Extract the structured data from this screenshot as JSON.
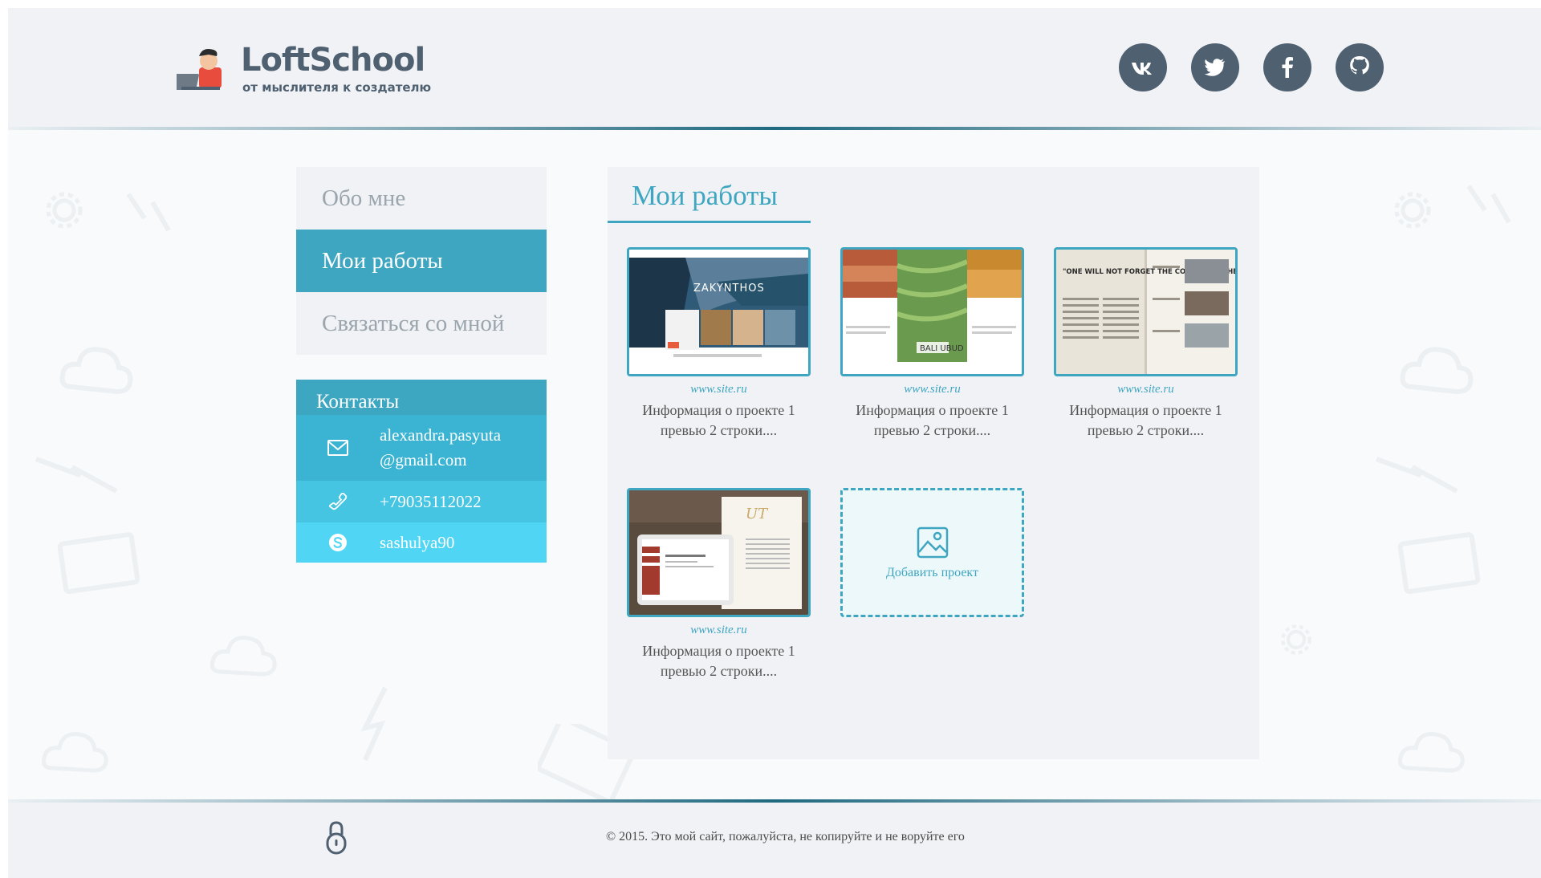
{
  "header": {
    "logo_title": "LoftSchool",
    "logo_subtitle": "от мыслителя к создателю",
    "socials": [
      "vk-icon",
      "twitter-icon",
      "facebook-icon",
      "github-icon"
    ]
  },
  "nav": {
    "items": [
      {
        "label": "Обо мне",
        "active": false
      },
      {
        "label": "Мои работы",
        "active": true
      },
      {
        "label": "Связаться со мной",
        "active": false
      }
    ]
  },
  "contacts": {
    "title": "Контакты",
    "email_line1": "alexandra.pasyuta",
    "email_line2": "@gmail.com",
    "phone": "+79035112022",
    "skype": "sashulya90"
  },
  "main": {
    "title": "Мои работы",
    "projects": [
      {
        "link": "www.site.ru",
        "desc_line1": "Информация о проекте 1",
        "desc_line2": "превью 2 строки....",
        "thumb_text": "ZAKYNTHOS"
      },
      {
        "link": "www.site.ru",
        "desc_line1": "Информация о проекте 1",
        "desc_line2": "превью 2 строки....",
        "thumb_text": "BALI UBUD"
      },
      {
        "link": "www.site.ru",
        "desc_line1": "Информация о проекте 1",
        "desc_line2": "превью 2 строки....",
        "thumb_text": "\"ONE WILL NOT FORGET THE COLOUR ON THESE WALLS.\""
      },
      {
        "link": "www.site.ru",
        "desc_line1": "Информация о проекте 1",
        "desc_line2": "превью 2 строки....",
        "thumb_text": "UT"
      }
    ],
    "add_label": "Добавить проект"
  },
  "footer": {
    "copyright": "© 2015. Это мой сайт, пожалуйста, не копируйте и не воруйте его"
  },
  "colors": {
    "accent": "#3ea6c1",
    "dark": "#4f6071",
    "panel": "#f0f2f5"
  }
}
